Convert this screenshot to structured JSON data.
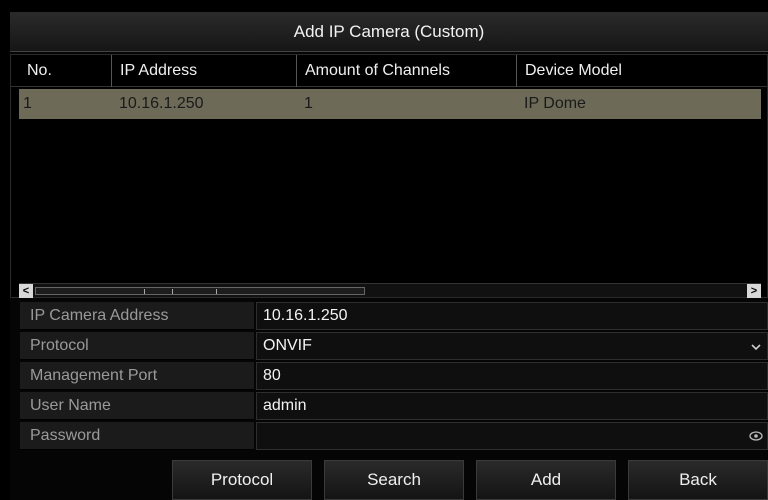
{
  "dialog": {
    "title": "Add IP Camera (Custom)"
  },
  "table": {
    "headers": [
      "No.",
      "IP Address",
      "Amount of Channels",
      "Device Model"
    ],
    "rows": [
      [
        "1",
        "10.16.1.250",
        "1",
        "IP Dome"
      ]
    ]
  },
  "scrollbar": {
    "left_arrow": "<",
    "right_arrow": ">"
  },
  "form": {
    "ip_camera_address": {
      "label": "IP Camera Address",
      "value": "10.16.1.250"
    },
    "protocol": {
      "label": "Protocol",
      "value": "ONVIF"
    },
    "management_port": {
      "label": "Management Port",
      "value": "80"
    },
    "user_name": {
      "label": "User Name",
      "value": "admin"
    },
    "password": {
      "label": "Password",
      "value": ""
    }
  },
  "buttons": {
    "protocol": "Protocol",
    "search": "Search",
    "add": "Add",
    "back": "Back"
  },
  "icons": {
    "dropdown": "chevron-down-icon",
    "password_toggle": "eye-icon"
  }
}
